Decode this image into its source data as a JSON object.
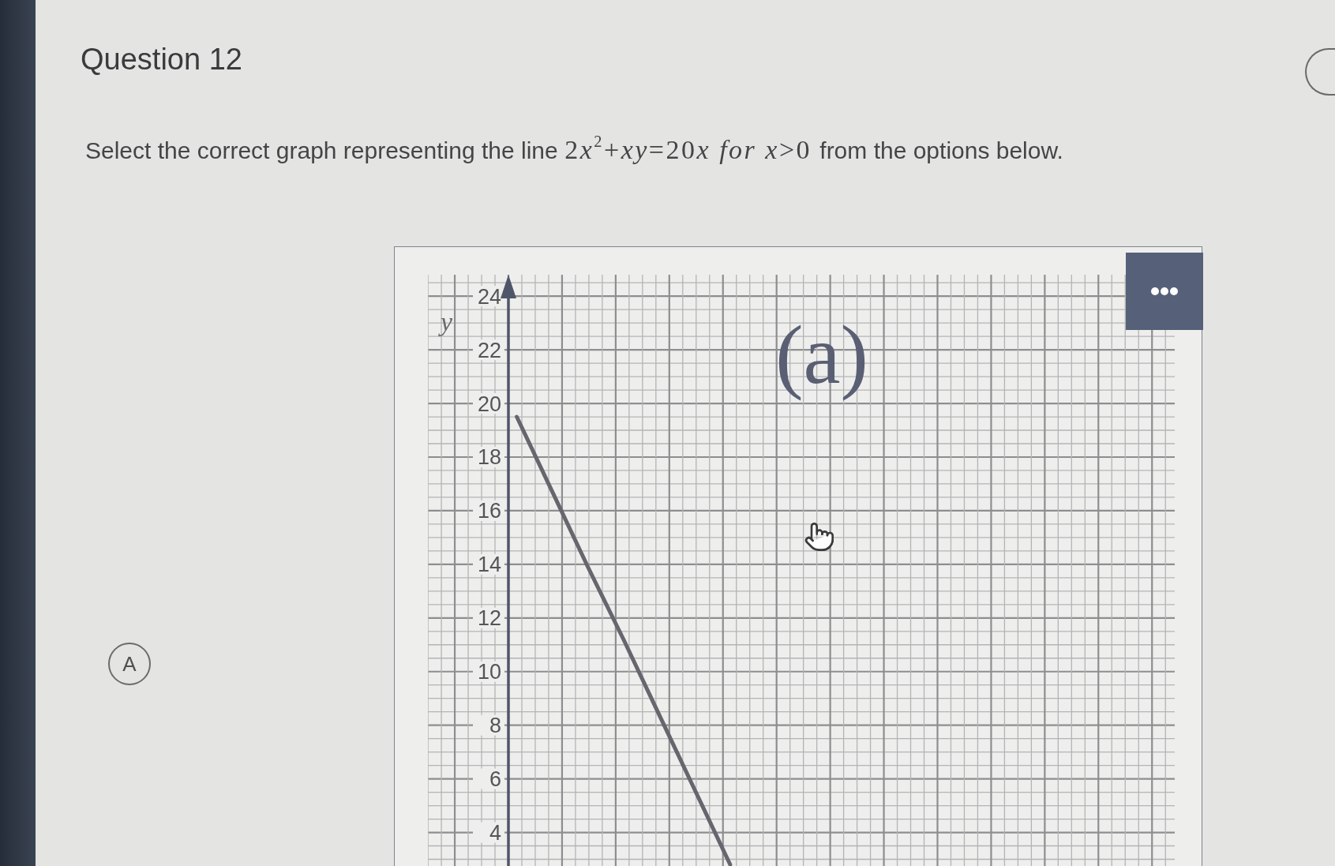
{
  "question": {
    "title": "Question 12"
  },
  "prompt": {
    "lead": "Select the correct graph representing the line",
    "math": [
      "2",
      "*x*$^{2}$+*xy*=20",
      "*x* *for* *x*>0"
    ],
    "tail": "from the options below."
  },
  "options": [
    {
      "letter": "A",
      "selected": false,
      "graph": {
        "chart_data": {
          "type": "line",
          "title": "(a)",
          "ylabel": "y",
          "grid": true,
          "categories": [
            null,
            null,
            null,
            null,
            null,
            null,
            null,
            null,
            null,
            null,
            null,
            null,
            null,
            null,
            null,
            null,
            null,
            null,
            null,
            null,
            null
          ],
          "series": [
            {
              "color": "#66666e",
              "values": [
                null,
                null,
                19.5,
                16.7,
                13.9,
                11.2,
                8.4,
                5.6,
                2.8,
                null,
                null,
                null,
                null,
                null,
                null,
                null,
                null,
                null,
                null,
                null,
                null
              ]
            }
          ],
          "ylim": [
            2.75,
            24.8
          ],
          "yticks": [
            4,
            6,
            8,
            10,
            12,
            14,
            16,
            18,
            20,
            22,
            24
          ]
        }
      }
    }
  ]
}
